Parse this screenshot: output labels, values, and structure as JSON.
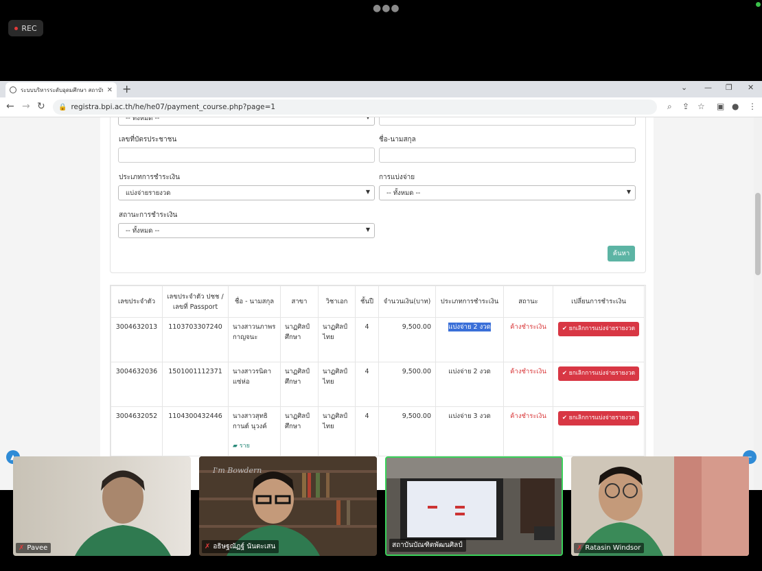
{
  "meeting": {
    "rec_label": "REC",
    "participants": [
      {
        "name": "Pavee"
      },
      {
        "name": "อธิษฐณัฏฐ์ นันตะเสน"
      },
      {
        "name": "สถาบันบัณฑิตพัฒนศิลป์"
      },
      {
        "name": "Ratasin Windsor"
      }
    ],
    "tile2_poster_text": "I'm Bowdern"
  },
  "browser": {
    "tab_title": "ระบบบริหารระดับอุดมศึกษา สถาบันบั",
    "url": "registra.bpi.ac.th/he/he07/payment_course.php?page=1"
  },
  "form": {
    "top_select_value": "-- ทั้งหมด --",
    "id_card_label": "เลขที่บัตรประชาชน",
    "fullname_label": "ชื่อ-นามสกุล",
    "payment_type_label": "ประเภทการชำระเงิน",
    "payment_type_value": "แบ่งจ่ายรายงวด",
    "split_label": "การแบ่งจ่าย",
    "split_value": "-- ทั้งหมด --",
    "status_label": "สถานะการชำระเงิน",
    "status_value": "-- ทั้งหมด --",
    "search_button": "ค้นหา"
  },
  "table": {
    "headers": [
      "เลขประจำตัว",
      "เลขประจำตัว ปชช / เลขที่ Passport",
      "ชื่อ - นามสกุล",
      "สาขา",
      "วิชาเอก",
      "ชั้นปี",
      "จำนวนเงิน(บาท)",
      "ประเภทการชำระเงิน",
      "สถานะ",
      "เปลี่ยนการชำระเงิน"
    ],
    "rows": [
      {
        "student_id": "3004632013",
        "citizen_id": "1103703307240",
        "name": "นางสาวนภาพร กาญจนะ",
        "branch": "นาฏศิลป์ศึกษา",
        "major": "นาฏศิลป์ไทย",
        "year": "4",
        "amount": "9,500.00",
        "payment_type": "แบ่งจ่าย 2 งวด",
        "status": "ค้างชำระเงิน",
        "action": "✔ ยกเลิกการแบ่งจ่ายรายงวด"
      },
      {
        "student_id": "3004632036",
        "citizen_id": "1501001112371",
        "name": "นางสาวรนิดา แซ่ห่อ",
        "branch": "นาฏศิลป์ศึกษา",
        "major": "นาฏศิลป์ไทย",
        "year": "4",
        "amount": "9,500.00",
        "payment_type": "แบ่งจ่าย 2 งวด",
        "status": "ค้างชำระเงิน",
        "action": "✔ ยกเลิกการแบ่งจ่ายรายงวด"
      },
      {
        "student_id": "3004632052",
        "citizen_id": "1104300432446",
        "name": "นางสาวสุทธิกานต์ นุวงค์",
        "branch": "นาฏศิลป์ศึกษา",
        "major": "นาฏศิลป์ไทย",
        "year": "4",
        "amount": "9,500.00",
        "payment_type": "แบ่งจ่าย 3 งวด",
        "status": "ค้างชำระเงิน",
        "action": "✔ ยกเลิกการแบ่งจ่ายรายงวด",
        "link": "ราย"
      }
    ]
  }
}
